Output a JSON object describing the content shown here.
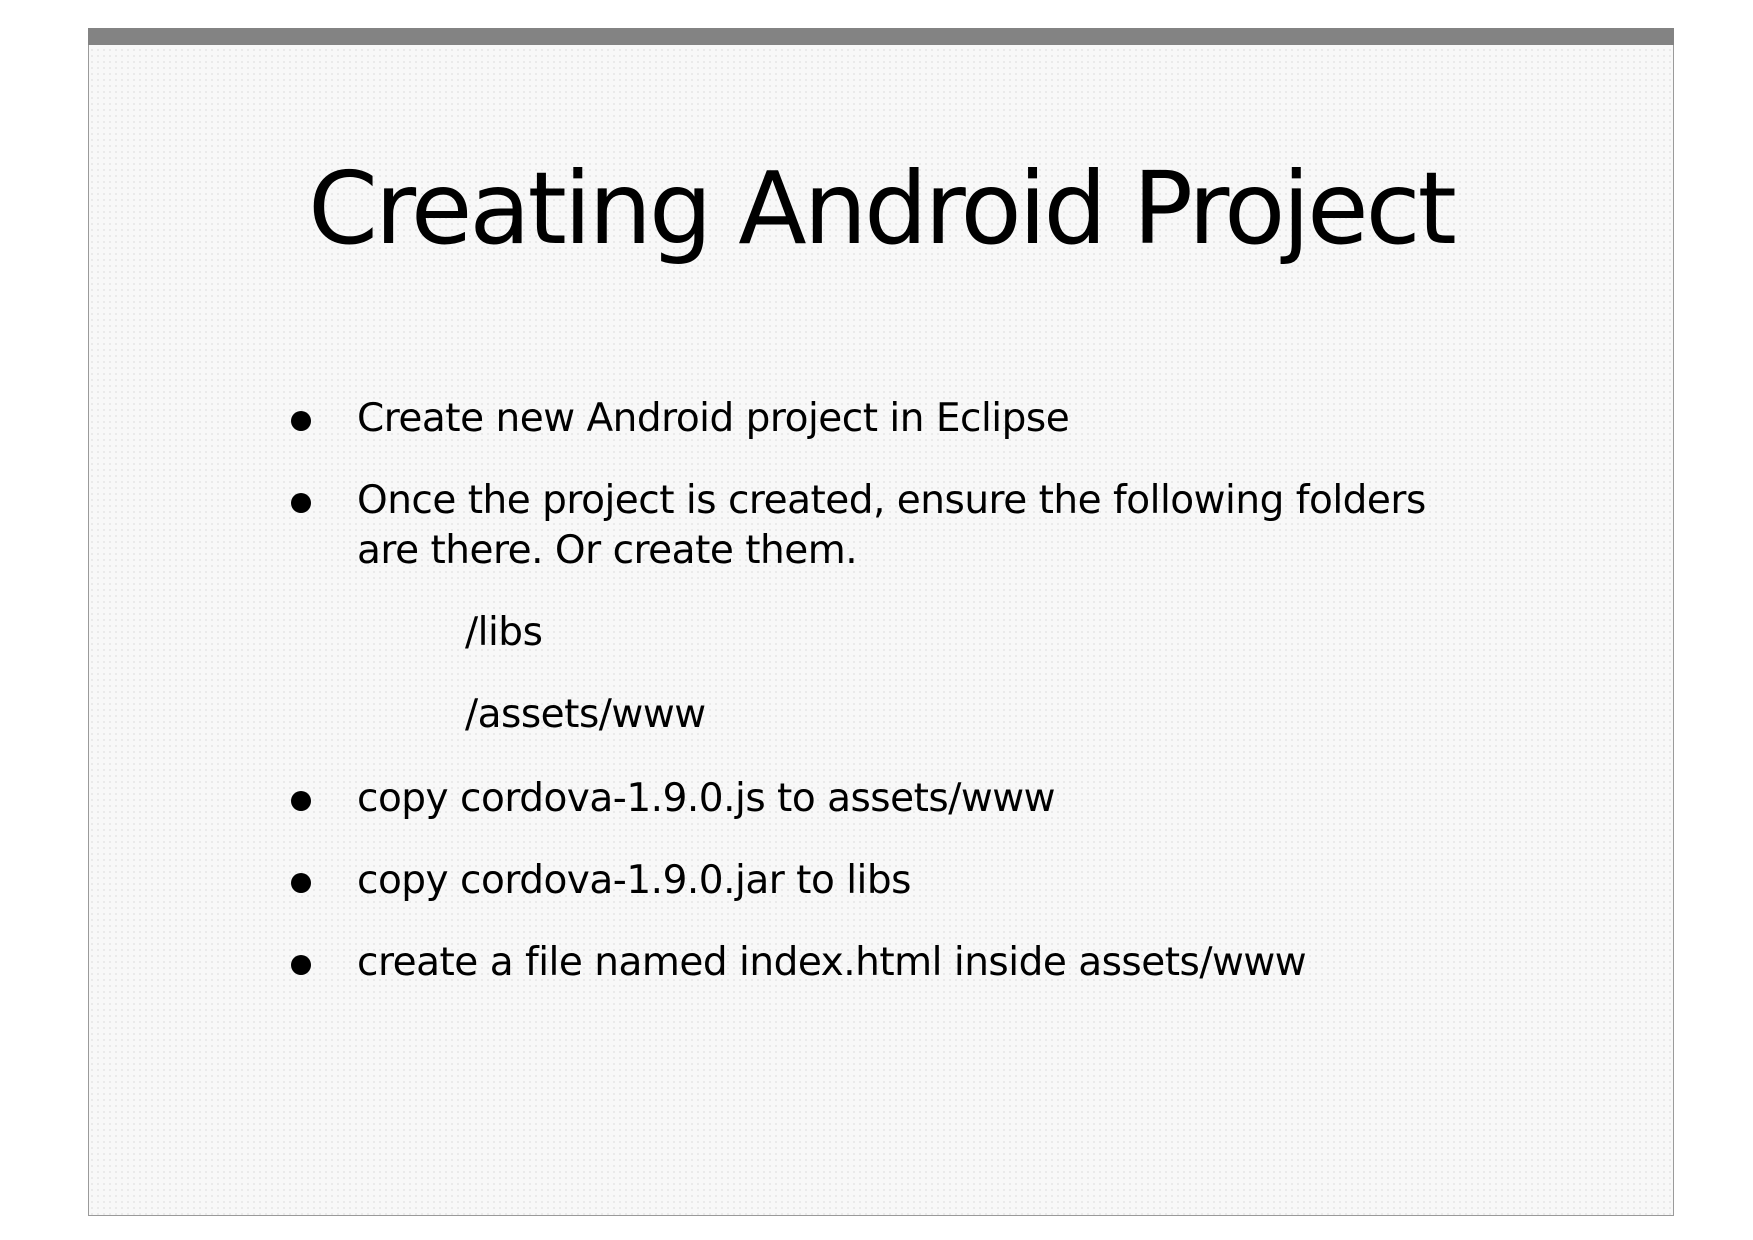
{
  "slide": {
    "title": "Creating Android Project",
    "bullets": [
      "Create new Android project in Eclipse",
      "Once the project is created, ensure the following folders",
      "are there. Or create them.",
      "copy cordova-1.9.0.js to assets/www",
      "copy cordova-1.9.0.jar to libs",
      "create a file named index.html inside assets/www"
    ],
    "folders": [
      "/libs",
      "/assets/www"
    ]
  }
}
